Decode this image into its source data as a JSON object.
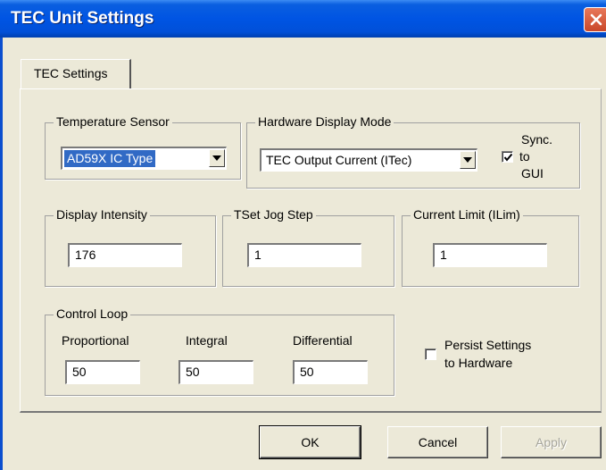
{
  "window": {
    "title": "TEC Unit Settings"
  },
  "tabs": [
    {
      "label": "TEC Settings",
      "active": true
    }
  ],
  "temperature_sensor": {
    "label": "Temperature Sensor",
    "selected": "AD59X IC Type"
  },
  "hardware_display_mode": {
    "label": "Hardware Display Mode",
    "selected": "TEC Output Current (ITec)",
    "sync": {
      "line1": "Sync.",
      "line2": "to",
      "line3": "GUI",
      "checked": true
    }
  },
  "display_intensity": {
    "label": "Display Intensity",
    "value": "176"
  },
  "tset_jog_step": {
    "label": "TSet Jog Step",
    "value": "1"
  },
  "current_limit": {
    "label": "Current Limit (ILim)",
    "value": "1"
  },
  "control_loop": {
    "label": "Control Loop",
    "proportional": {
      "label": "Proportional",
      "value": "50"
    },
    "integral": {
      "label": "Integral",
      "value": "50"
    },
    "differential": {
      "label": "Differential",
      "value": "50"
    }
  },
  "persist": {
    "line1": "Persist Settings",
    "line2": "to Hardware",
    "checked": false
  },
  "buttons": {
    "ok": "OK",
    "cancel": "Cancel",
    "apply": "Apply"
  },
  "colors": {
    "titlebar": "#0054E3",
    "dialog_bg": "#ECE9D8",
    "selection": "#316AC5",
    "close_button": "#C9472A"
  },
  "icons": {
    "close": "close-icon",
    "dropdown": "chevron-down-icon",
    "check": "check-icon"
  }
}
